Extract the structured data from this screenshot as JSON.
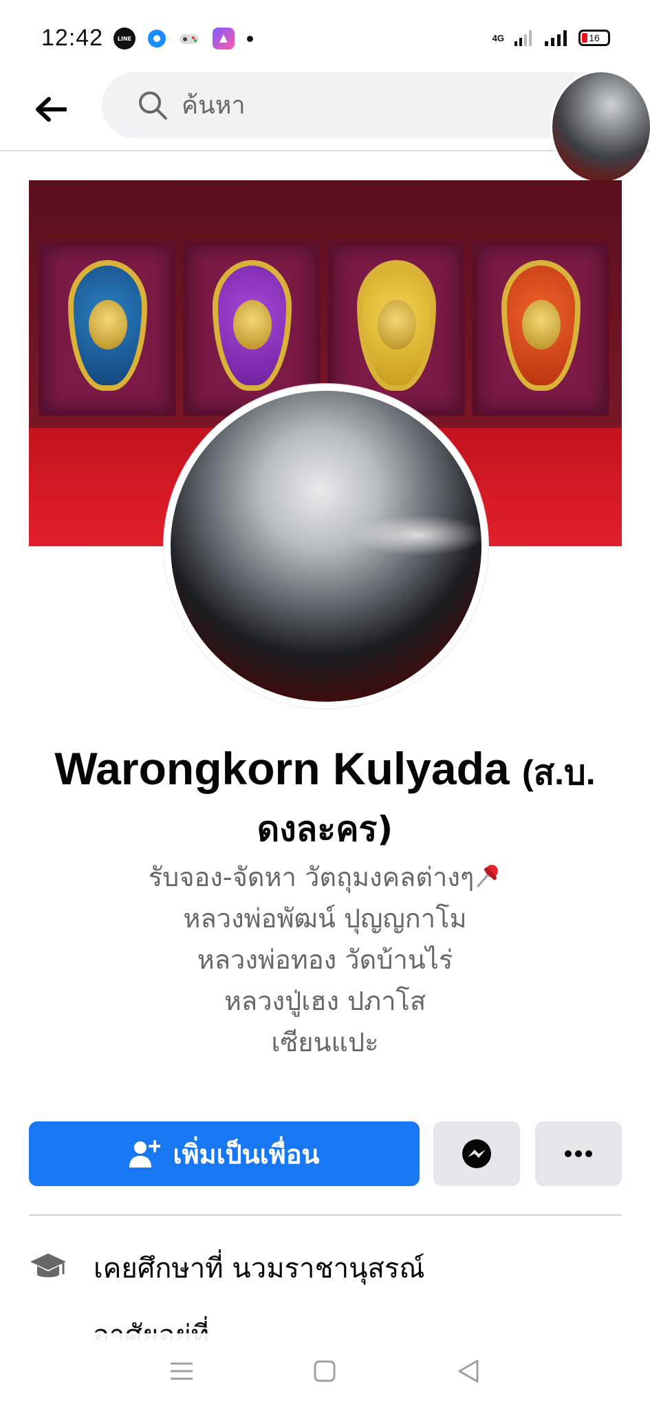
{
  "status_bar": {
    "time": "12:42",
    "network": "4G",
    "battery": "16",
    "notification_icons": [
      "line-icon",
      "messenger-lite-icon",
      "game-icon",
      "app-icon"
    ]
  },
  "header": {
    "search_placeholder": "ค้นหา"
  },
  "profile": {
    "name": "Warongkorn Kulyada",
    "name_suffix": "(ส.บ.",
    "name_suffix_line2": "ดงละคร)",
    "bio": [
      "รับจอง-จัดหา วัตถุมงคลต่างๆ",
      "หลวงพ่อพัฒน์ ปุญญกาโม",
      "หลวงพ่อทอง  วัดบ้านไร่",
      "หลวงปู่เฮง ปภาโส",
      "เซียนแปะ"
    ]
  },
  "actions": {
    "add_friend_label": "เพิ่มเป็นเพื่อน"
  },
  "intro": {
    "education": "เคยศึกษาที่ นวมราชานุสรณ์",
    "partial_next": "อาศัยอยู่ที่"
  },
  "colors": {
    "primary": "#1877f2",
    "secondary_button": "#e4e6eb",
    "text_secondary": "#65676b"
  }
}
